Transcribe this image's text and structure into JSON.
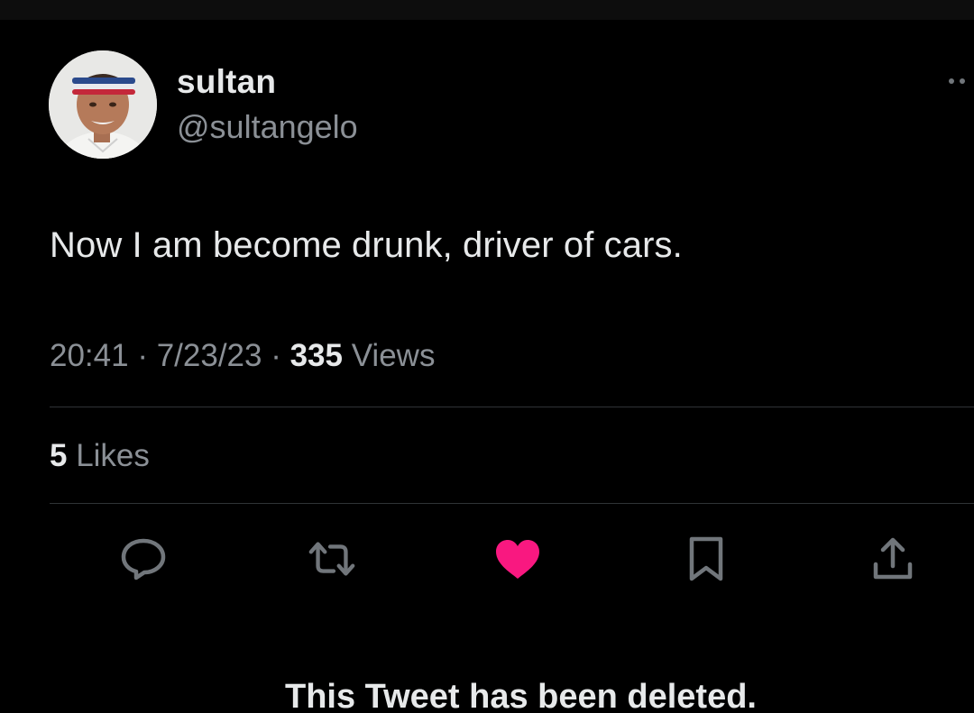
{
  "author": {
    "display_name": "sultan",
    "handle": "@sultangelo",
    "avatar_icon": "profile-photo"
  },
  "tweet": {
    "text": "Now I am become drunk, driver of cars."
  },
  "meta": {
    "time": "20:41",
    "separator": " · ",
    "date": "7/23/23",
    "views_count": "335",
    "views_label": " Views"
  },
  "engagement": {
    "likes_count": "5",
    "likes_label": " Likes"
  },
  "actions": [
    {
      "name": "reply",
      "icon": "speech-bubble-icon"
    },
    {
      "name": "retweet",
      "icon": "retweet-arrows-icon"
    },
    {
      "name": "like",
      "icon": "heart-icon",
      "active": true
    },
    {
      "name": "bookmark",
      "icon": "bookmark-icon"
    },
    {
      "name": "share",
      "icon": "share-upload-icon"
    }
  ],
  "caption": "This Tweet has been deleted.",
  "colors": {
    "background": "#000000",
    "primary_text": "#e7e9ea",
    "secondary_text": "#8b9096",
    "icon_gray": "#71767b",
    "like_pink": "#f91880",
    "divider": "#2f3336"
  }
}
